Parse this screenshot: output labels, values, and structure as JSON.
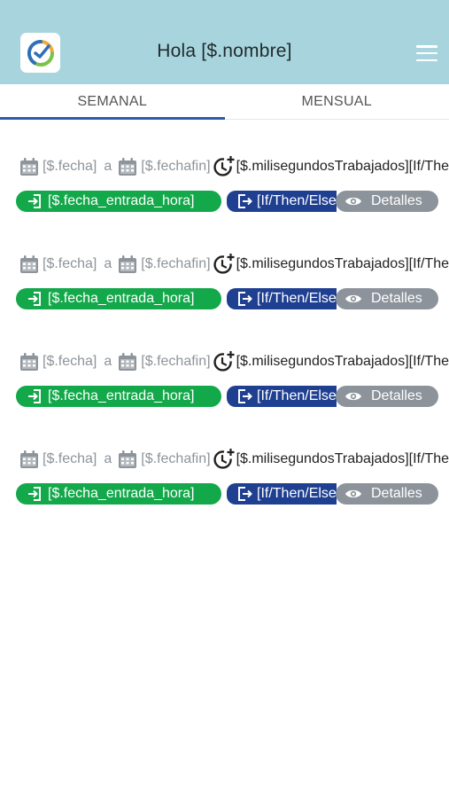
{
  "header": {
    "title": "Hola [$.nombre]",
    "logo_icon": "checkmark-circle-logo-icon",
    "menu_icon": "hamburger-menu-icon",
    "bg_color": "#a8d5dd"
  },
  "tabs": [
    {
      "label": "SEMANAL",
      "active": true
    },
    {
      "label": "MENSUAL",
      "active": false
    }
  ],
  "records": [
    {
      "fecha": "[$.fecha]",
      "separator": "a",
      "fechafin": "[$.fechafin]",
      "worked": "[$.milisegundosTrabajados][If/Then/Else]",
      "entrada": "[$.fecha_entrada_hora]",
      "salida": "[If/Then/Else]",
      "detalles": "Detalles"
    },
    {
      "fecha": "[$.fecha]",
      "separator": "a",
      "fechafin": "[$.fechafin]",
      "worked": "[$.milisegundosTrabajados][If/Then/Else]",
      "entrada": "[$.fecha_entrada_hora]",
      "salida": "[If/Then/Else]",
      "detalles": "Detalles"
    },
    {
      "fecha": "[$.fecha]",
      "separator": "a",
      "fechafin": "[$.fechafin]",
      "worked": "[$.milisegundosTrabajados][If/Then/Else]",
      "entrada": "[$.fecha_entrada_hora]",
      "salida": "[If/Then/Else]",
      "detalles": "Detalles"
    },
    {
      "fecha": "[$.fecha]",
      "separator": "a",
      "fechafin": "[$.fechafin]",
      "worked": "[$.milisegundosTrabajados][If/Then/Else]",
      "entrada": "[$.fecha_entrada_hora]",
      "salida": "[If/Then/Else]",
      "detalles": "Detalles"
    }
  ],
  "icons": {
    "date_start": "calendar-icon",
    "date_end": "calendar-icon",
    "worked_time": "clock-plus-icon",
    "entrada": "sign-in-icon",
    "salida": "sign-out-icon",
    "detalles": "eye-icon"
  },
  "colors": {
    "accent": "#2f5aa8",
    "entrada": "#13a84a",
    "salida": "#1f3f91",
    "detalles": "#8c939b"
  }
}
